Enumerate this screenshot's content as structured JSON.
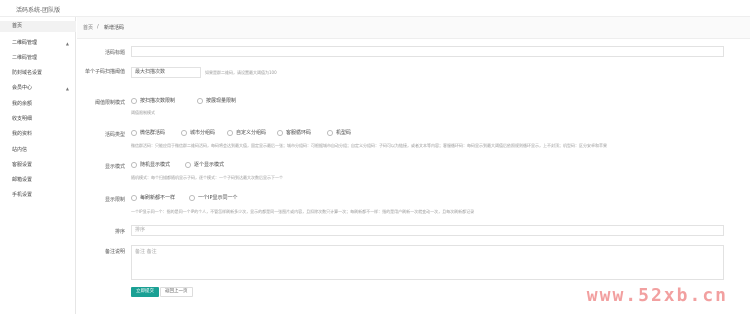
{
  "header": {
    "app_title": "活码系统-团队版"
  },
  "sidebar": {
    "items": [
      {
        "label": "首页"
      },
      {
        "label": "二维码管理"
      },
      {
        "label": "二维码管理"
      },
      {
        "label": "防封域名设置"
      },
      {
        "label": "会员中心"
      },
      {
        "label": "我的余额"
      },
      {
        "label": "收支明细"
      },
      {
        "label": "我的资料"
      },
      {
        "label": "站内信"
      },
      {
        "label": "客服设置"
      },
      {
        "label": "邮箱设置"
      },
      {
        "label": "手机设置"
      }
    ]
  },
  "breadcrumb": {
    "home": "首页",
    "sep": "/",
    "current": "新增活码"
  },
  "form": {
    "title_label": "活码标题",
    "title_value": "",
    "max_scan_label": "单个子码扫描阈值",
    "max_scan_placeholder": "最大扫描次数",
    "max_scan_hint": "如果是群二维码，请设置最大阈值为100",
    "threshold_label": "阈值限制模式",
    "threshold_opts": [
      "按扫描次数限制",
      "按展现量限制"
    ],
    "threshold_hint": "阈值限制模式",
    "type_label": "活码类型",
    "type_opts": [
      "微信群活码",
      "城市分组码",
      "自定义分组码",
      "客服循环码",
      "机型码"
    ],
    "type_hint": "微信群活码：只能应用于微信群二维码活码，每码将会达到最大值，固定显示最后一张；城市分组码：可根据城市自动分组；自定义分组码：子码可以为链接，或者文本等内容；客服循环码：每码显示到最大阈值后依照规则循环显示，上不封顶；机型码：区分安卓和苹果",
    "display_label": "显示模式",
    "display_opts": [
      "随机显示模式",
      "逐个显示模式"
    ],
    "display_hint": "随机模式：每个扫描都随机显示子码，逐个模式：一个子码到达最大次数后显示下一个",
    "limit_label": "显示限制",
    "limit_opts": [
      "每刷新都不一样",
      "一个IP显示同一个"
    ],
    "limit_hint": "一个IP显示同一个：指的是同一个IP的个人，不管怎样刷新多少次，显示的都是同一张图片或内容，且扣除次数只计算一次；每刷新都不一样：指的是用户刷新一次就变动一次，且每次刷新都记录",
    "sort_label": "排序",
    "sort_placeholder": "排序",
    "note_label": "备注说明",
    "note_placeholder": "备注 备注",
    "submit_label": "立即提交",
    "back_label": "返回上一页"
  },
  "watermark": "www.52xb.cn"
}
